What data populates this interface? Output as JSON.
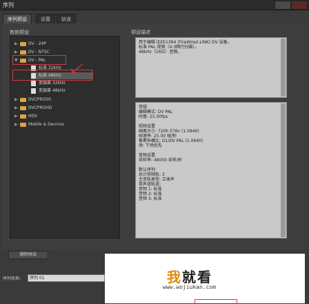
{
  "window": {
    "title": "序列"
  },
  "tabs": [
    {
      "label": "序列预设",
      "active": true
    },
    {
      "label": "设置",
      "active": false
    },
    {
      "label": "轨道",
      "active": false
    }
  ],
  "presets": {
    "label": "有效预设",
    "items": [
      {
        "label": "DV - 24P",
        "type": "folder",
        "expanded": false
      },
      {
        "label": "DV - NTSC",
        "type": "folder",
        "expanded": false
      },
      {
        "label": "DV - PAL",
        "type": "folder",
        "expanded": true
      },
      {
        "label": "标准 32kHz",
        "type": "file"
      },
      {
        "label": "标准 48kHz",
        "type": "file",
        "selected": true
      },
      {
        "label": "宽银幕 32kHz",
        "type": "file"
      },
      {
        "label": "宽银幕 48kHz",
        "type": "file"
      },
      {
        "label": "DVCPRO50",
        "type": "folder",
        "expanded": false
      },
      {
        "label": "DVCPROHD",
        "type": "folder",
        "expanded": false
      },
      {
        "label": "HDV",
        "type": "folder",
        "expanded": false
      },
      {
        "label": "Mobile & Devices",
        "type": "folder",
        "expanded": false
      }
    ]
  },
  "description": {
    "label": "预设描述",
    "lines": [
      "用于编辑 IEEE1394 (FireWire/i.LINK) DV 设备。",
      "标准 PAL 视频（4:3隔行扫描）。",
      "48kHz（16位）音频。"
    ]
  },
  "details": {
    "lines": [
      "常规",
      "编辑模式: DV PAL",
      "时基: 25.00fps",
      "",
      "视频设置",
      "画面大小: 720h 576v (1.0940)",
      "帧速率: 25.00 帧/秒",
      "像素纵横比: D1/DV PAL (1.0940)",
      "场: 下场优先",
      "",
      "音频设置",
      "采样率: 48000 采样/秒",
      "",
      "默认序列",
      "总计视频轨: 3",
      "主音轨类型: 立体声",
      "单声道轨道:",
      "音频 1: 标准",
      "音频 2: 标准",
      "音频 3: 标准"
    ]
  },
  "buttons": {
    "delete_preset": "删除预设"
  },
  "sequence_name": {
    "label": "序列名称:",
    "value": "序列 01"
  },
  "watermark": {
    "brand": "我就看",
    "brand_first": "我",
    "brand_rest": "就看",
    "url": "www.wojiukan.com"
  }
}
